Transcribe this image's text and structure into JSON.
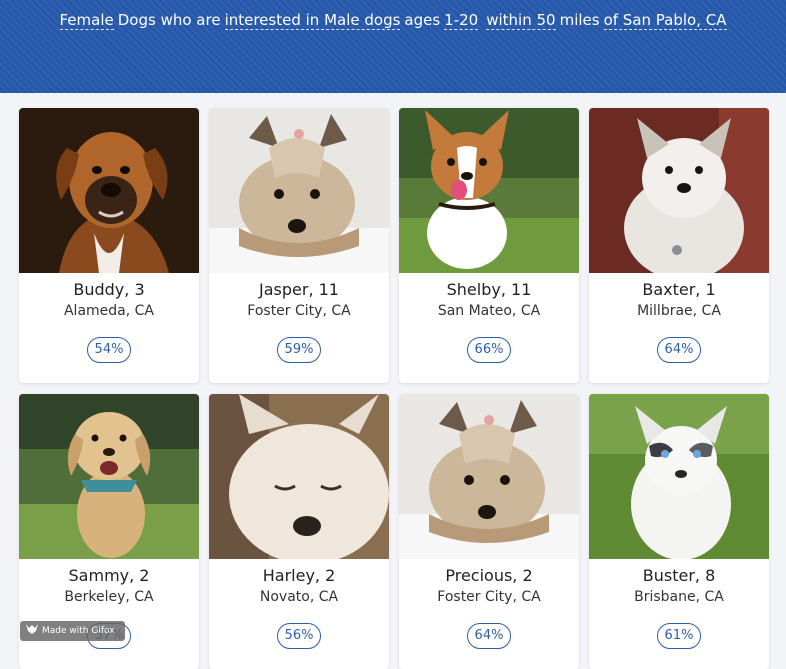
{
  "search": {
    "gender": "Female",
    "subject": "Dogs who are",
    "interest": "interested in Male dogs",
    "ages_label": "ages",
    "age_range": "1-20",
    "distance": "within 50",
    "miles_label": "miles",
    "location": "of San Pablo, CA"
  },
  "dogs": [
    {
      "name": "Buddy, 3",
      "location": "Alameda, CA",
      "match": "54%",
      "photo": "boxer-photo"
    },
    {
      "name": "Jasper, 11",
      "location": "Foster City, CA",
      "match": "59%",
      "photo": "yorkie-photo"
    },
    {
      "name": "Shelby, 11",
      "location": "San Mateo, CA",
      "match": "66%",
      "photo": "corgi-photo"
    },
    {
      "name": "Baxter, 1",
      "location": "Millbrae, CA",
      "match": "64%",
      "photo": "fluffy-dog-photo"
    },
    {
      "name": "Sammy, 2",
      "location": "Berkeley, CA",
      "match": "57%",
      "photo": "doodle-photo"
    },
    {
      "name": "Harley, 2",
      "location": "Novato, CA",
      "match": "56%",
      "photo": "sleepy-white-dog-photo"
    },
    {
      "name": "Precious, 2",
      "location": "Foster City, CA",
      "match": "64%",
      "photo": "yorkie-photo"
    },
    {
      "name": "Buster, 8",
      "location": "Brisbane, CA",
      "match": "61%",
      "photo": "husky-puppy-photo"
    }
  ],
  "watermark": {
    "text": "Made with Gifox",
    "icon": "gifox-logo-icon"
  },
  "colors": {
    "header": "#2558aa",
    "accent": "#2f5ea8",
    "page_bg": "#f3f4f8"
  }
}
